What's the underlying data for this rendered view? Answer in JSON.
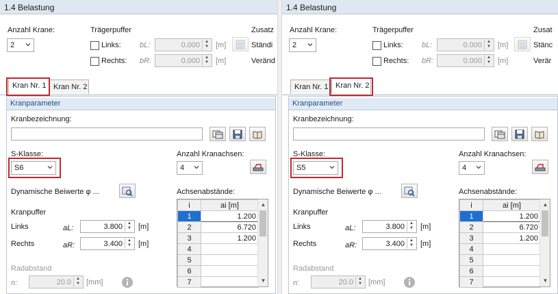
{
  "panels": [
    {
      "title": "1.4 Belastung",
      "anzahl_krane_label": "Anzahl Krane:",
      "anzahl_krane_value": "2",
      "traegerpuffer_label": "Trägerpuffer",
      "links_label": "Links:",
      "rechts_label": "Rechts:",
      "bL_sub": "bL:",
      "bR_sub": "bR:",
      "bL_value": "0.000",
      "bR_value": "0.000",
      "unit_m": "[m]",
      "right_clip_1": "Zusatz",
      "right_clip_2": "Ständi",
      "right_clip_3": "Veränd",
      "tabs": [
        "Kran Nr. 1",
        "Kran Nr. 2"
      ],
      "active_tab": 0,
      "section_title": "Kranparameter",
      "kranbezeichnung_label": "Kranbezeichnung:",
      "kranbezeichnung_value": "",
      "s_klasse_label": "S-Klasse:",
      "s_klasse_value": "S6",
      "anzahl_achsen_label": "Anzahl Kranachsen:",
      "anzahl_achsen_value": "4",
      "dyn_label": "Dynamische Beiwerte φ ...",
      "achsenabstaende_label": "Achsenabstände:",
      "kranpuffer_label": "Kranpuffer",
      "kp_links_label": "Links",
      "kp_rechts_label": "Rechts",
      "aL_sub": "aL:",
      "aR_sub": "aR:",
      "aL_value": "3.800",
      "aR_value": "3.400",
      "radabstand_label": "Radabstand",
      "n_sub": "n:",
      "n_value": "20.0",
      "unit_mm": "[mm]",
      "grid_head_i": "i",
      "grid_head_a": "ai [m]",
      "grid_rows": [
        {
          "i": "1",
          "a": "1.200"
        },
        {
          "i": "2",
          "a": "6.720"
        },
        {
          "i": "3",
          "a": "1.200"
        },
        {
          "i": "4",
          "a": ""
        },
        {
          "i": "5",
          "a": ""
        },
        {
          "i": "6",
          "a": ""
        },
        {
          "i": "7",
          "a": ""
        }
      ]
    },
    {
      "title": "1.4 Belastung",
      "anzahl_krane_label": "Anzahl Krane:",
      "anzahl_krane_value": "2",
      "traegerpuffer_label": "Trägerpuffer",
      "links_label": "Links:",
      "rechts_label": "Rechts:",
      "bL_sub": "bL:",
      "bR_sub": "bR:",
      "bL_value": "0.000",
      "bR_value": "0.000",
      "unit_m": "[m]",
      "right_clip_1": "Zusat",
      "right_clip_2": "Stänc",
      "right_clip_3": "Verär",
      "tabs": [
        "Kran Nr. 1",
        "Kran Nr. 2"
      ],
      "active_tab": 1,
      "section_title": "Kranparameter",
      "kranbezeichnung_label": "Kranbezeichnung:",
      "kranbezeichnung_value": "",
      "s_klasse_label": "S-Klasse:",
      "s_klasse_value": "S5",
      "anzahl_achsen_label": "Anzahl Kranachsen:",
      "anzahl_achsen_value": "4",
      "dyn_label": "Dynamische Beiwerte φ ...",
      "achsenabstaende_label": "Achsenabstände:",
      "kranpuffer_label": "Kranpuffer",
      "kp_links_label": "Links",
      "kp_rechts_label": "Rechts",
      "aL_sub": "aL:",
      "aR_sub": "aR:",
      "aL_value": "3.800",
      "aR_value": "3.400",
      "radabstand_label": "Radabstand",
      "n_sub": "n:",
      "n_value": "20.0",
      "unit_mm": "[mm]",
      "grid_head_i": "i",
      "grid_head_a": "ai [m]",
      "grid_rows": [
        {
          "i": "1",
          "a": "1.200"
        },
        {
          "i": "2",
          "a": "6.720"
        },
        {
          "i": "3",
          "a": "1.200"
        },
        {
          "i": "4",
          "a": ""
        },
        {
          "i": "5",
          "a": ""
        },
        {
          "i": "6",
          "a": ""
        },
        {
          "i": "7",
          "a": ""
        }
      ]
    }
  ],
  "colors": {
    "highlight": "#c0282d",
    "selection": "#1f6fd0",
    "section_title": "#1f4f8a"
  }
}
